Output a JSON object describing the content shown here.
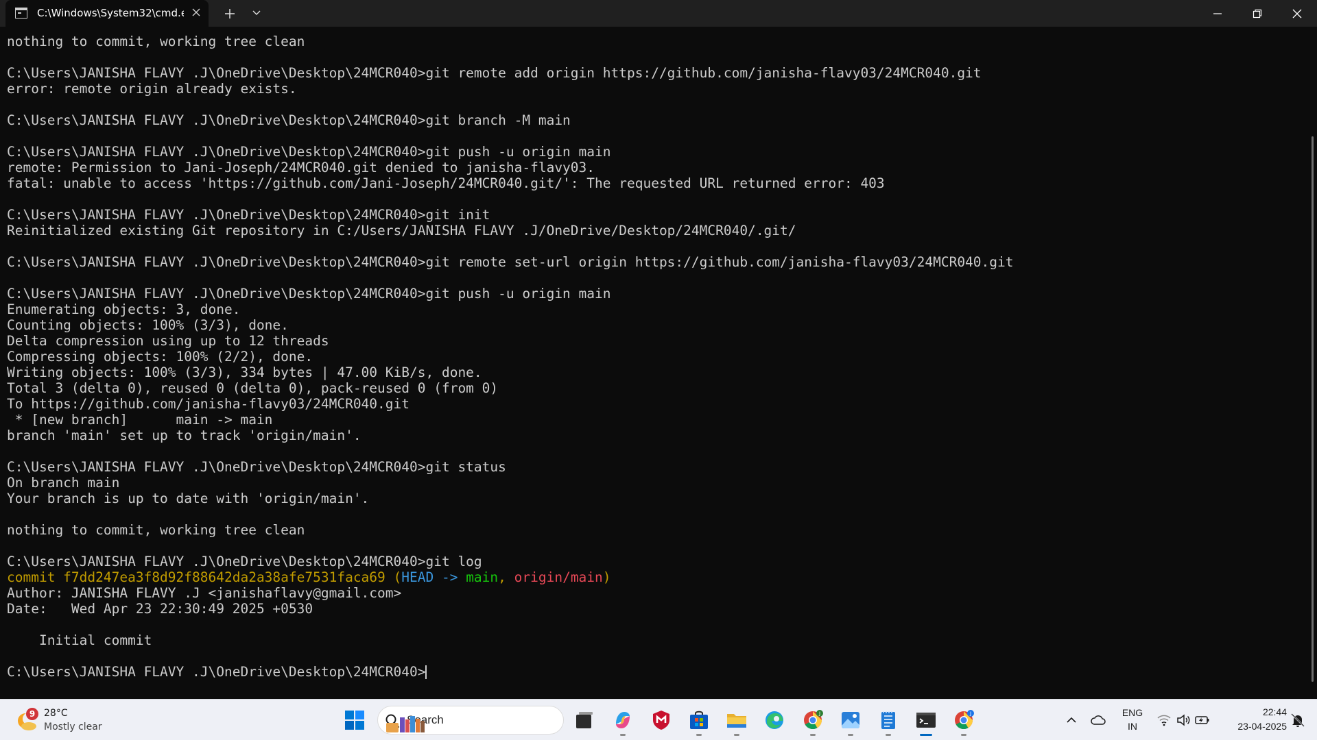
{
  "window": {
    "tab_title": "C:\\Windows\\System32\\cmd.e",
    "tab_icon": "cmd-icon",
    "close_tab_icon": "close-icon",
    "new_tab_icon": "plus-icon",
    "dropdown_icon": "chevron-down-icon"
  },
  "terminal": {
    "colors": {
      "background": "#0c0c0c",
      "foreground": "#cccccc",
      "commit_hash": "#c19c00",
      "head": "#3a96dd",
      "branch_local": "#16c60c",
      "branch_remote": "#e74856"
    },
    "lines": {
      "l01": "nothing to commit, working tree clean",
      "l02": "C:\\Users\\JANISHA FLAVY .J\\OneDrive\\Desktop\\24MCR040>git remote add origin https://github.com/janisha-flavy03/24MCR040.git",
      "l03": "error: remote origin already exists.",
      "l04": "C:\\Users\\JANISHA FLAVY .J\\OneDrive\\Desktop\\24MCR040>git branch -M main",
      "l05": "C:\\Users\\JANISHA FLAVY .J\\OneDrive\\Desktop\\24MCR040>git push -u origin main",
      "l06": "remote: Permission to Jani-Joseph/24MCR040.git denied to janisha-flavy03.",
      "l07": "fatal: unable to access 'https://github.com/Jani-Joseph/24MCR040.git/': The requested URL returned error: 403",
      "l08": "C:\\Users\\JANISHA FLAVY .J\\OneDrive\\Desktop\\24MCR040>git init",
      "l09": "Reinitialized existing Git repository in C:/Users/JANISHA FLAVY .J/OneDrive/Desktop/24MCR040/.git/",
      "l10": "C:\\Users\\JANISHA FLAVY .J\\OneDrive\\Desktop\\24MCR040>git remote set-url origin https://github.com/janisha-flavy03/24MCR040.git",
      "l11": "C:\\Users\\JANISHA FLAVY .J\\OneDrive\\Desktop\\24MCR040>git push -u origin main",
      "l12": "Enumerating objects: 3, done.",
      "l13": "Counting objects: 100% (3/3), done.",
      "l14": "Delta compression using up to 12 threads",
      "l15": "Compressing objects: 100% (2/2), done.",
      "l16": "Writing objects: 100% (3/3), 334 bytes | 47.00 KiB/s, done.",
      "l17": "Total 3 (delta 0), reused 0 (delta 0), pack-reused 0 (from 0)",
      "l18": "To https://github.com/janisha-flavy03/24MCR040.git",
      "l19": " * [new branch]      main -> main",
      "l20": "branch 'main' set up to track 'origin/main'.",
      "l21": "C:\\Users\\JANISHA FLAVY .J\\OneDrive\\Desktop\\24MCR040>git status",
      "l22": "On branch main",
      "l23": "Your branch is up to date with 'origin/main'.",
      "l24": "nothing to commit, working tree clean",
      "l25": "C:\\Users\\JANISHA FLAVY .J\\OneDrive\\Desktop\\24MCR040>git log",
      "l27": "Author: JANISHA FLAVY .J <janishaflavy@gmail.com>",
      "l28": "Date:   Wed Apr 23 22:30:49 2025 +0530",
      "l29": "    Initial commit",
      "l30": "C:\\Users\\JANISHA FLAVY .J\\OneDrive\\Desktop\\24MCR040>"
    },
    "log_line": {
      "hash": "commit f7dd247ea3f8d92f88642da2a38afe7531faca69",
      "open": " (",
      "head": "HEAD -> ",
      "branch": "main",
      "sep": ", ",
      "remote": "origin/main",
      "close": ")"
    }
  },
  "taskbar": {
    "weather": {
      "badge": "9",
      "temp": "28°C",
      "condition": "Mostly clear"
    },
    "search": {
      "placeholder": "Search"
    },
    "pinned_icons": [
      "windows-start-icon",
      "search-icon",
      "task-view-icon",
      "copilot-icon",
      "mcafee-icon",
      "microsoft-store-icon",
      "file-explorer-icon",
      "edge-icon",
      "chrome-icon",
      "photos-icon",
      "notepad-icon",
      "terminal-icon",
      "chrome-profile-icon"
    ],
    "tray": {
      "chevron": "chevron-up-icon",
      "onedrive": "cloud-icon",
      "lang_primary": "ENG",
      "lang_secondary": "IN",
      "wifi": "wifi-icon",
      "volume": "volume-icon",
      "battery": "battery-charging-icon",
      "notification_badge": "notification-icon",
      "time": "22:44",
      "date": "23-04-2025"
    }
  }
}
